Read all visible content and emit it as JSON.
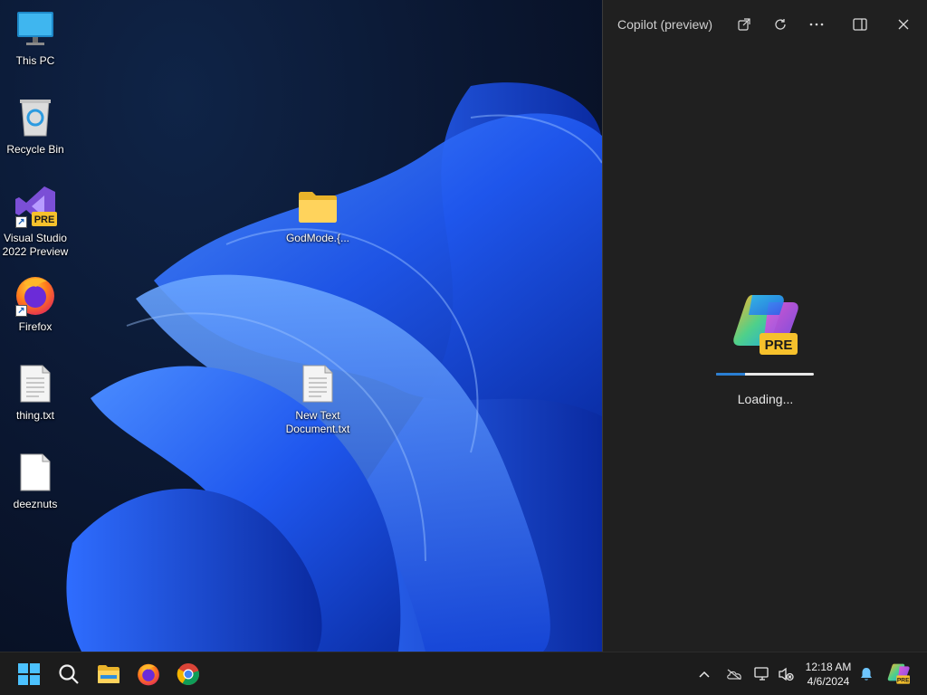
{
  "desktop": {
    "icons": [
      {
        "label": "This PC",
        "icon": "this-pc-icon"
      },
      {
        "label": "Recycle Bin",
        "icon": "recycle-bin-icon"
      },
      {
        "label": "Visual Studio 2022 Preview",
        "icon": "visual-studio-preview-icon",
        "badge": "PRE"
      },
      {
        "label": "Firefox",
        "icon": "firefox-icon"
      },
      {
        "label": "thing.txt",
        "icon": "text-file-icon"
      },
      {
        "label": "deeznuts",
        "icon": "blank-file-icon"
      },
      {
        "label": "GodMode.{...",
        "icon": "folder-icon"
      },
      {
        "label": "New Text Document.txt",
        "icon": "text-file-icon"
      }
    ]
  },
  "copilot": {
    "title": "Copilot (preview)",
    "badge": "PRE",
    "loading_text": "Loading...",
    "progress": 0.3,
    "buttons": [
      "open-in-new-icon",
      "refresh-icon",
      "more-icon",
      "dock-icon",
      "close-icon"
    ]
  },
  "taskbar": {
    "apps": [
      "start-icon",
      "search-icon",
      "file-explorer-icon",
      "firefox-icon",
      "chrome-icon"
    ],
    "tray": [
      "chevron-up-icon",
      "onedrive-icon",
      "network-icon",
      "volume-muted-icon",
      "notification-bell-icon",
      "copilot-icon"
    ],
    "time": "12:18 AM",
    "date": "4/6/2024",
    "copilot_badge": "PRE"
  },
  "colors": {
    "taskbar": "#1c1c1c",
    "copilot_pane": "#202020",
    "accent": "#2a7fd4",
    "pre_badge": "#f6c12c"
  }
}
